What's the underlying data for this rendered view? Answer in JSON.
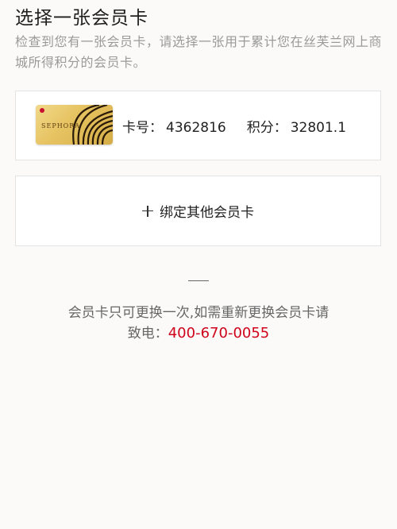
{
  "header": {
    "title": "选择一张会员卡",
    "description": "检查到您有一张会员卡，请选择一张用于累计您在丝芙兰网上商城所得积分的会员卡。"
  },
  "member_card": {
    "brand": "SEPHORA",
    "card_number_label": "卡号：",
    "card_number": "4362816",
    "points_label": "积分：",
    "points": "32801.1"
  },
  "bind_other": {
    "label": "绑定其他会员卡"
  },
  "notice": {
    "line1": "会员卡只可更换一次,如需重新更换会员卡请",
    "line2_prefix": "致电：",
    "phone": "400-670-0055"
  },
  "colors": {
    "background": "#fbfaf9",
    "phone": "#d0021b",
    "card_gold": "#e7c463"
  }
}
